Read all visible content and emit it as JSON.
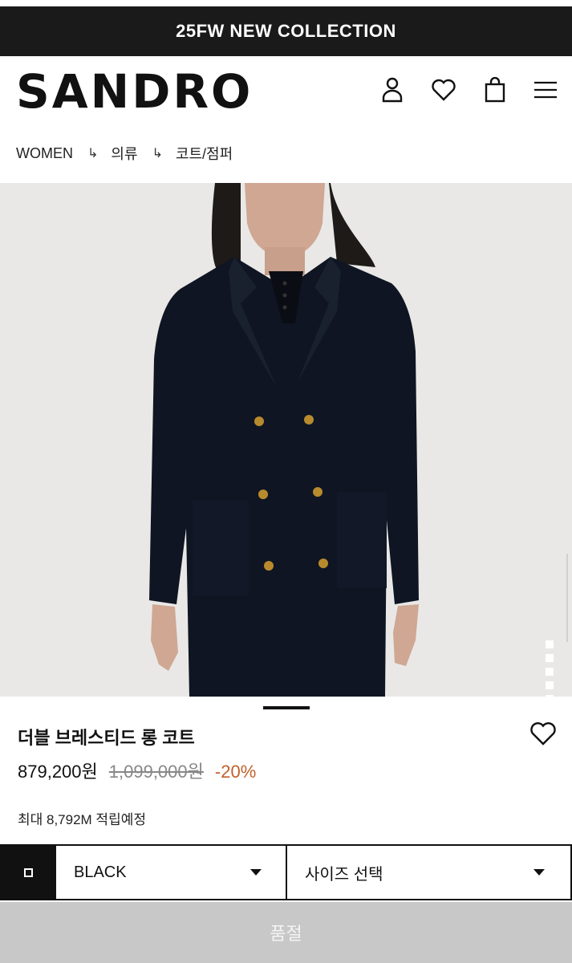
{
  "promo": {
    "text": "25FW NEW COLLECTION"
  },
  "header": {
    "logo": "SANDRO",
    "icons": [
      "account-icon",
      "heart-icon",
      "shopping-bag-icon",
      "menu-icon"
    ]
  },
  "breadcrumb": {
    "items": [
      "WOMEN",
      "의류",
      "코트/점퍼"
    ],
    "separator": "↳"
  },
  "gallery": {
    "slide_count": 7,
    "active_index": 5
  },
  "product": {
    "name": "더블 브레스티드 롱 코트",
    "price": "879,200원",
    "original_price": "1,099,000원",
    "discount": "-20%",
    "points": "최대 8,792M 적립예정"
  },
  "selectors": {
    "color_value": "BLACK",
    "size_placeholder": "사이즈 선택"
  },
  "action": {
    "label": "품절"
  },
  "colors": {
    "promo_bg": "#1a1a1a",
    "discount": "#c0602a",
    "soldout_bg": "#c8c8c8"
  }
}
